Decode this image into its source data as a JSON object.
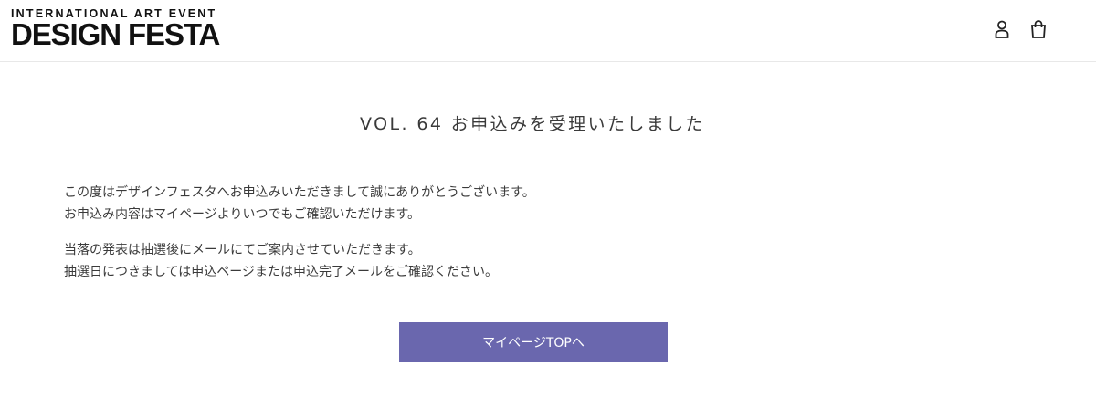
{
  "header": {
    "logo": {
      "sub": "INTERNATIONAL ART EVENT",
      "main": "DESIGN FESTA"
    },
    "icons": [
      "account-icon",
      "cart-icon"
    ]
  },
  "main": {
    "title": "VOL. 64 お申込みを受理いたしました",
    "paragraphs": [
      {
        "line1": "この度はデザインフェスタへお申込みいただきまして誠にありがとうございます。",
        "line2": "お申込み内容はマイページよりいつでもご確認いただけます。"
      },
      {
        "line1": "当落の発表は抽選後にメールにてご案内させていただきます。",
        "line2": "抽選日につきましては申込ページまたは申込完了メールをご確認ください。"
      }
    ],
    "button_label": "マイページTOPへ"
  },
  "colors": {
    "button_bg": "#6a67ae",
    "button_text": "#ffffff",
    "text": "#3a3a3a",
    "header_border": "#e8e8e8"
  }
}
